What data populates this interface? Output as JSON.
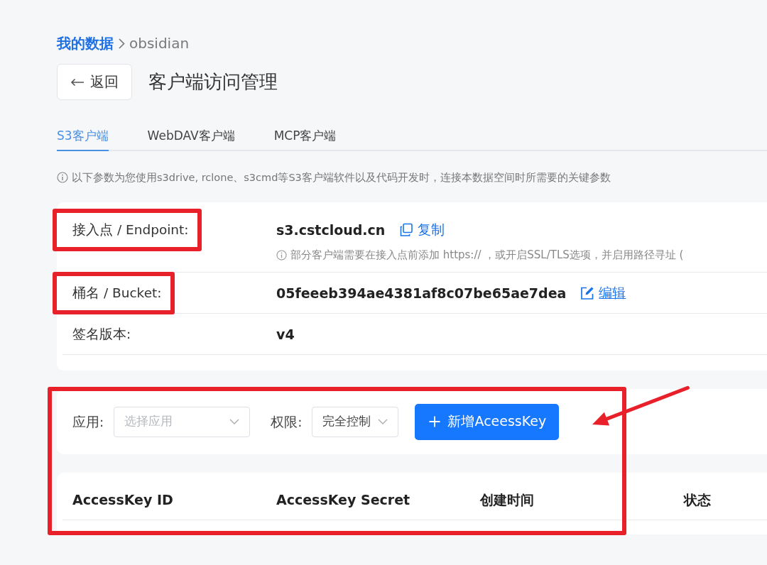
{
  "breadcrumb": [
    {
      "label": "我的数据",
      "kind": "link"
    },
    {
      "label": "obsidian",
      "kind": "current"
    }
  ],
  "header": {
    "back_button": "返回",
    "title": "客户端访问管理"
  },
  "tabs": [
    {
      "label": "S3客户端",
      "selected": true
    },
    {
      "label": "WebDAV客户端",
      "selected": false
    },
    {
      "label": "MCP客户端",
      "selected": false
    }
  ],
  "notice": "以下参数为您使用s3drive, rclone、s3cmd等S3客户端软件以及代码开发时，连接本数据空间时所需要的关键参数",
  "params": [
    {
      "label": "接入点 / Endpoint:",
      "value": "s3.cstcloud.cn",
      "action": {
        "kind": "copy",
        "label": "复制"
      },
      "hint": "部分客户端需要在接入点前添加 https:// ，或开启SSL/TLS选项，并启用路径寻址 (",
      "highlighted": true
    },
    {
      "label": "桶名 / Bucket:",
      "value": "05feeeb394ae4381af8c07be65ae7dea",
      "action": {
        "kind": "edit",
        "label": "编辑"
      },
      "highlighted": true
    },
    {
      "label": "签名版本:",
      "value": "v4",
      "highlighted": false
    }
  ],
  "key_panel": {
    "highlighted": true,
    "filters": [
      {
        "label": "应用:",
        "placeholder": "选择应用"
      },
      {
        "label": "权限:",
        "value": "完全控制"
      }
    ],
    "add_button": {
      "label": "新增AceessKey",
      "pointed_at": true
    },
    "table": {
      "columns": [
        "AccessKey ID",
        "AccessKey Secret",
        "创建时间",
        "状态"
      ]
    }
  }
}
